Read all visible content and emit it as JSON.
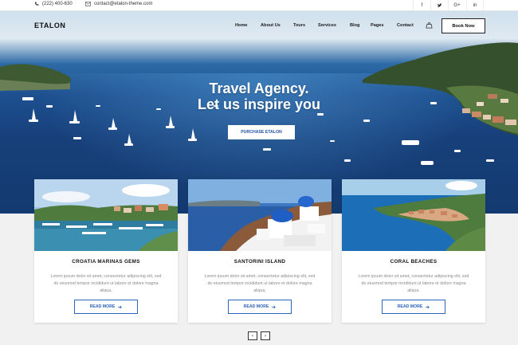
{
  "topbar": {
    "phone": "(222) 400-630",
    "email": "contact@etalon-theme.com",
    "social": [
      "f",
      "t-icon",
      "G+",
      "in"
    ]
  },
  "nav": {
    "logo": "ETALON",
    "items": [
      "Home",
      "About Us",
      "Tours",
      "Services",
      "Blog",
      "Pages",
      "Contact"
    ],
    "book_label": "Book Now"
  },
  "hero": {
    "title_line1": "Travel Agency.",
    "title_line2": "Let us inspire you",
    "cta_label": "PURCHASE ETALON"
  },
  "cards": [
    {
      "title": "CROATIA MARINAS GEMS",
      "desc": "Lorem ipsum dolor sit amet, consectetur adipiscing elit, sed do eiusmod tempor incididunt ut labore et dolore magna aliqua.",
      "button": "READ MORE"
    },
    {
      "title": "SANTORINI ISLAND",
      "desc": "Lorem ipsum dolor sit amet, consectetur adipiscing elit, sed do eiusmod tempor incididunt ut labore et dolore magna aliqua.",
      "button": "READ MORE"
    },
    {
      "title": "CORAL BEACHES",
      "desc": "Lorem ipsum dolor sit amet, consectetur adipiscing elit, sed do eiusmod tempor incididunt ut labore et dolore magna aliqua.",
      "button": "READ MORE"
    }
  ],
  "pager": {
    "prev": "‹",
    "next": "›"
  },
  "colors": {
    "accent": "#2c65c0",
    "sea": "#1d4f8f"
  }
}
